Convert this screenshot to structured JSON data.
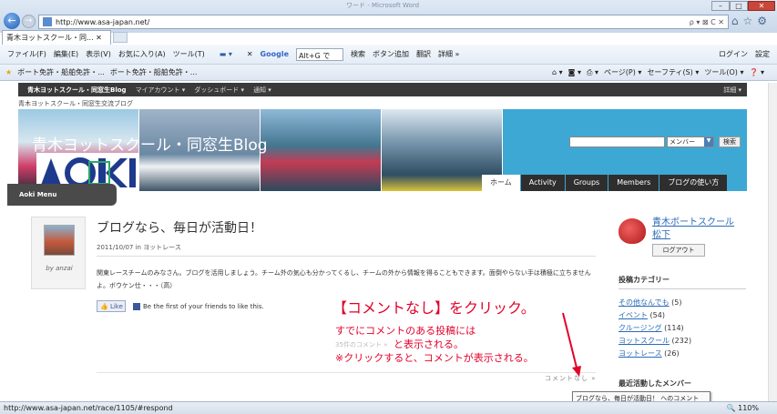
{
  "browser": {
    "url": "http://www.asa-japan.net/",
    "window_title": "ワード - Microsoft Word",
    "address_tools": "ρ ▾ ⊠ C ✕",
    "tab_label": "青木ヨットスクール・同... ✕",
    "menu": {
      "file": "ファイル(F)",
      "edit": "編集(E)",
      "view": "表示(V)",
      "favorites": "お気に入り(A)",
      "tools": "ツール(T)",
      "google_logo": "Google",
      "search_field": "Alt+G で",
      "search_btn": "検索",
      "add_btn": "ボタン追加",
      "translate": "翻訳",
      "more": "詳細 »",
      "login": "ログイン",
      "settings": "設定"
    },
    "favbar": {
      "items": [
        "ボート免許・船舶免許・...",
        "ボート免許・船舶免許・..."
      ],
      "right": [
        "ページ(P) ▾",
        "セーフティ(S) ▾",
        "ツール(O) ▾",
        "❓ ▾"
      ]
    },
    "status_url": "http://www.asa-japan.net/race/1105/#respond",
    "zoom": "🔍 110%",
    "tooltip": "ブログなら、毎日が活動日！ へのコメント"
  },
  "site": {
    "admin_bar": [
      "青木ヨットスクール・同窓生Blog",
      "マイアカウント ▾",
      "ダッシュボード ▾",
      "通知 ▾"
    ],
    "admin_right": "詳細 ▾",
    "subtitle": "青木ヨットスクール・同窓生交流ブログ",
    "banner_title": "青木ヨットスクール・同窓生Blog",
    "logo_text": "AOKI",
    "search_scope": "メンバー",
    "search_btn": "検索",
    "nav_tabs": [
      "ホーム",
      "Activity",
      "Groups",
      "Members",
      "ブログの使い方"
    ],
    "aoki_menu": "Aoki Menu"
  },
  "post": {
    "title": "ブログなら、毎日が活動日！",
    "date": "2011/10/07 in ヨットレース",
    "byline": "by anzai",
    "body": "関東レースチームのみなさん。ブログを活用しましょう。チーム外の気心も分かってくるし、チームの外から情報を得ることもできます。面倒やらない手は積極に立ちませんよ。ボウケン仕・・・（高）",
    "like": "👍 Like",
    "like_text": "Be the first of your friends to like this.",
    "faded_comments": "35件のコメント »",
    "comment_link": "コメントなし »"
  },
  "annotation": {
    "headline": "【コメントなし】をクリック。",
    "line1": "すでにコメントのある投稿には",
    "line2": "と表示される。",
    "line3": "※クリックすると、コメントが表示される。",
    "color": "#e3002a"
  },
  "sidebar": {
    "member_name": "青木ボートスクール 松下",
    "logout": "ログアウト",
    "category_heading": "投稿カテゴリー",
    "categories": [
      {
        "name": "その他なんでも",
        "count": "(5)"
      },
      {
        "name": "イベント",
        "count": "(54)"
      },
      {
        "name": "クルージング",
        "count": "(114)"
      },
      {
        "name": "ヨットスクール",
        "count": "(232)"
      },
      {
        "name": "ヨットレース",
        "count": "(26)"
      }
    ],
    "recent_heading": "最近活動したメンバー"
  }
}
